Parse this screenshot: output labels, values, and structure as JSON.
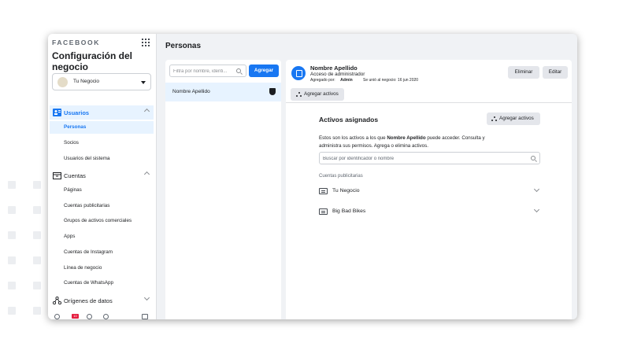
{
  "sidebar": {
    "brand": "FACEBOOK",
    "title": "Configuración del negocio",
    "business_selector": {
      "value": "Tu Negocio"
    },
    "groups": [
      {
        "label": "Usuarios",
        "expanded": true,
        "active": true,
        "items": [
          "Personas",
          "Socios",
          "Usuarios del sistema"
        ],
        "active_item": "Personas"
      },
      {
        "label": "Cuentas",
        "expanded": true,
        "items": [
          "Páginas",
          "Cuentas publicitarias",
          "Grupos de activos comerciales",
          "Apps",
          "Cuentas de Instagram",
          "Línea de negocio",
          "Cuentas de WhatsApp"
        ]
      },
      {
        "label": "Orígenes de datos",
        "expanded": false
      }
    ],
    "bottom_badge": "10"
  },
  "main": {
    "title": "Personas",
    "filter": {
      "placeholder": "Filtra por nombre, identi...",
      "value": ""
    },
    "add_button": "Agregar",
    "people": [
      {
        "name": "Nombre Apellido"
      }
    ]
  },
  "detail": {
    "name": "Nombre Apellido",
    "role": "Acceso de administrador",
    "added_by_label": "Agregado por:",
    "added_by_value": "Admin",
    "joined": "Se unió al negocio: 16 jun 2020",
    "delete_button": "Eliminar",
    "edit_button": "Editar",
    "add_assets_button": "Agregar activos",
    "assets": {
      "title": "Activos asignados",
      "add_button": "Agregar activos",
      "desc_prefix": "Estos son los activos a los que ",
      "desc_name": "Nombre Apellido",
      "desc_suffix": " puede acceder. Consulta y administra sus permisos. Agrega o elimina activos.",
      "search_placeholder": "Buscar por identificador o nombre",
      "section_label": "Cuentas publicitarias",
      "items": [
        {
          "label": "Tu Negocio"
        },
        {
          "label": "Big Bad Bikes"
        }
      ]
    }
  },
  "colors": {
    "accent": "#1877f2",
    "active_bg": "#e7f3ff",
    "page_bg": "#f0f2f5"
  }
}
